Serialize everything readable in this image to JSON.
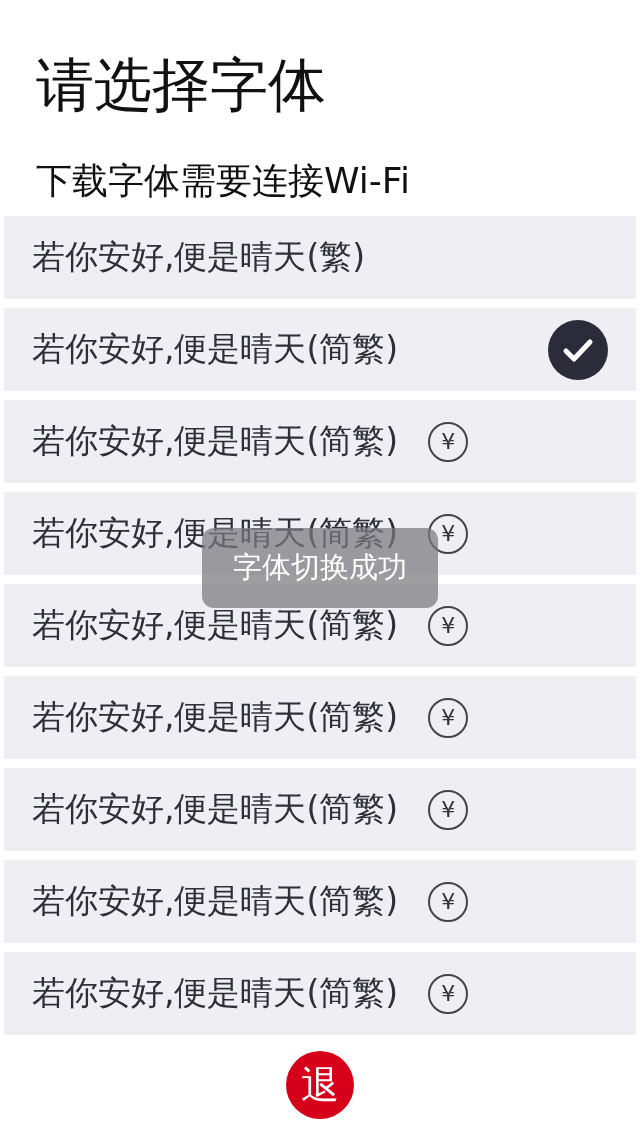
{
  "title": "请选择字体",
  "subtitle": "下载字体需要连接Wi-Fi",
  "fonts": [
    {
      "text": "若你安好,便是晴天(繁)",
      "selected": false
    },
    {
      "text": "若你安好,便是晴天(简繁)",
      "selected": true
    },
    {
      "text": "若你安好,便是晴天(简繁)",
      "selected": false,
      "badge": "¥"
    },
    {
      "text": "若你安好,便是晴天(简繁)",
      "selected": false,
      "badge": "¥"
    },
    {
      "text": "若你安好,便是晴天(简繁)",
      "selected": false,
      "badge": "¥"
    },
    {
      "text": "若你安好,便是晴天(简繁)",
      "selected": false,
      "badge": "¥"
    },
    {
      "text": "若你安好,便是晴天(简繁)",
      "selected": false,
      "badge": "¥"
    },
    {
      "text": "若你安好,便是晴天(简繁)",
      "selected": false,
      "badge": "¥"
    },
    {
      "text": "若你安好,便是晴天(简繁)",
      "selected": false,
      "badge": "¥"
    }
  ],
  "toast": "字体切换成功",
  "exit_button": "退"
}
